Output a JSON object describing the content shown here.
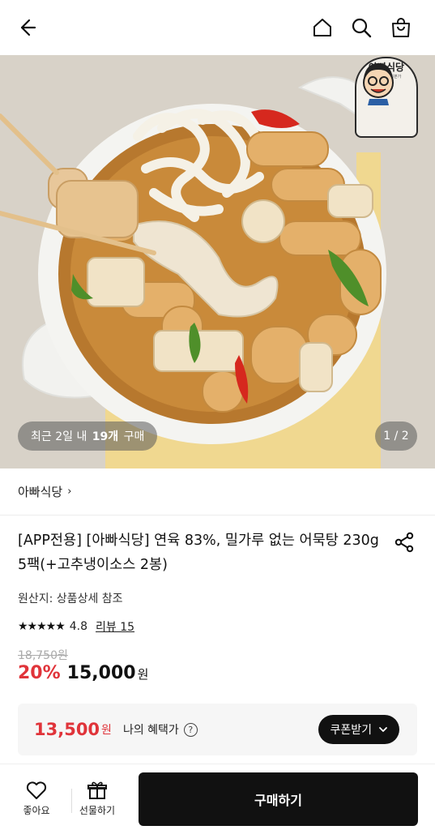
{
  "header": {
    "back_icon": "arrow-left-icon",
    "home_icon": "home-icon",
    "search_icon": "search-icon",
    "cart_icon": "shopping-bag-icon"
  },
  "hero": {
    "recent_prefix": "최근 2일 내",
    "recent_count": "19개",
    "recent_suffix": "구매",
    "counter": "1 / 2",
    "logo_text": "아빠식당",
    "logo_sub": "전통진미요리본가"
  },
  "store": {
    "name": "아빠식당",
    "chevron": "›"
  },
  "product": {
    "title": "[APP전용] [아빠식당] 연육 83%, 밀가루 없는 어묵탕 230g 5팩(+고추냉이소스 2봉)",
    "origin": "원산지: 상품상세 참조",
    "rating_stars": "★★★★★",
    "rating": "4.8",
    "review_label": "리뷰 15",
    "original_price": "18,750원",
    "discount": "20%",
    "price": "15,000",
    "price_unit": "원"
  },
  "benefit": {
    "price": "13,500",
    "unit": "원",
    "label": "나의 혜택가",
    "help": "?",
    "coupon_label": "쿠폰받기",
    "coupon_chevron": "⌄"
  },
  "bottom": {
    "like_label": "좋아요",
    "gift_label": "선물하기",
    "buy_label": "구매하기"
  },
  "colors": {
    "accent_red": "#e0343a",
    "dark": "#111111"
  }
}
